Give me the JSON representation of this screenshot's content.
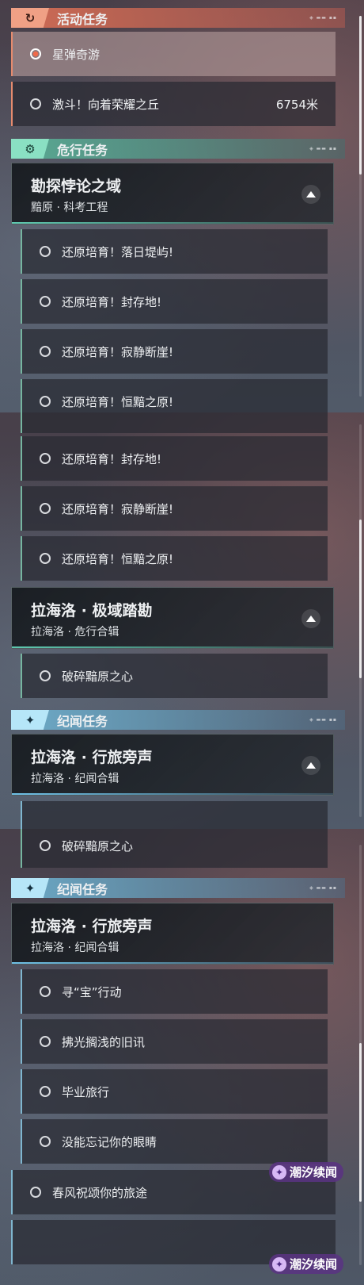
{
  "sections": {
    "activity": {
      "title": "活动任务",
      "icon": "refresh-icon"
    },
    "danger": {
      "title": "危行任务",
      "icon": "gear-icon"
    },
    "story": {
      "title": "纪闻任务",
      "icon": "sparkle-icon"
    }
  },
  "activity_quests": {
    "q1": {
      "label": "星弹奇游"
    },
    "q2": {
      "label": "激斗！向着荣耀之丘",
      "distance": "6754米"
    }
  },
  "groups": {
    "paradox": {
      "name": "勘探悖论之域",
      "subtitle": "黯原 · 科考工程"
    },
    "laharo_polar": {
      "name": "拉海洛 · 极域踏勘",
      "subtitle": "拉海洛 · 危行合辑"
    },
    "laharo_travel": {
      "name": "拉海洛 · 行旅旁声",
      "subtitle": "拉海洛 · 纪闻合辑"
    }
  },
  "danger_quests": {
    "sunset": "还原培育！落日堤屿!",
    "sealed": "还原培育！封存地!",
    "cliff": "还原培育！寂静断崖!",
    "plain": "还原培育！恒黯之原!",
    "heart": "破碎黯原之心"
  },
  "story_quests": {
    "treasure": "寻“宝”行动",
    "old_news": "拂光搁浅的旧讯",
    "graduation": "毕业旅行",
    "eyes": "没能忘记你的眼睛",
    "spring": "春风祝颂你的旅途"
  },
  "watermark": {
    "text": "潮汐续闻"
  },
  "colors": {
    "activity": "#e58b6e",
    "danger": "#5fc9b0",
    "story": "#6fc1e6"
  }
}
